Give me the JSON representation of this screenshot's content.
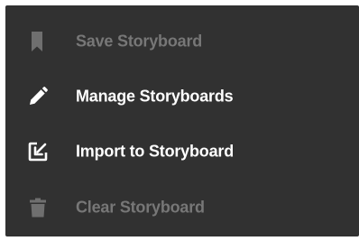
{
  "menu": {
    "items": [
      {
        "label": "Save Storyboard",
        "icon": "bookmark-icon",
        "enabled": false
      },
      {
        "label": "Manage Storyboards",
        "icon": "pencil-icon",
        "enabled": true
      },
      {
        "label": "Import to Storyboard",
        "icon": "import-icon",
        "enabled": true
      },
      {
        "label": "Clear Storyboard",
        "icon": "trash-icon",
        "enabled": false
      }
    ]
  },
  "colors": {
    "menu_background": "#313131",
    "enabled_text": "#ffffff",
    "disabled_text": "#777777",
    "disabled_icon": "#6f6f6f"
  }
}
